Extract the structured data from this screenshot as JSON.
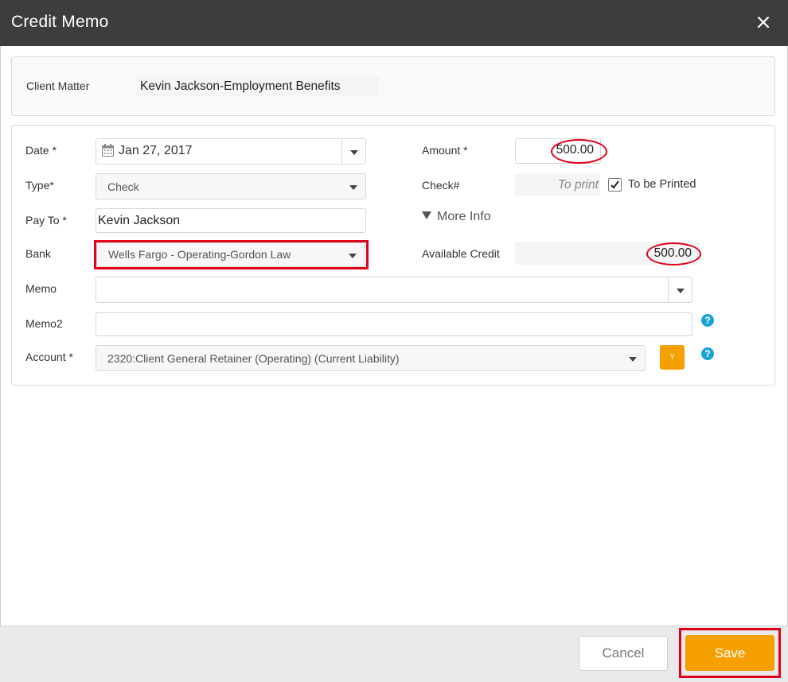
{
  "dialog": {
    "title": "Credit Memo"
  },
  "client_matter": {
    "label": "Client Matter",
    "value": "Kevin Jackson-Employment Benefits"
  },
  "form": {
    "date": {
      "label": "Date *",
      "value": "Jan 27, 2017"
    },
    "type": {
      "label": "Type*",
      "value": "Check"
    },
    "pay_to": {
      "label": "Pay To *",
      "value": "Kevin Jackson"
    },
    "bank": {
      "label": "Bank",
      "value": "Wells Fargo - Operating-Gordon Law"
    },
    "memo": {
      "label": "Memo",
      "value": ""
    },
    "memo2": {
      "label": "Memo2",
      "value": ""
    },
    "account": {
      "label": "Account *",
      "value": "2320:Client General Retainer (Operating) (Current Liability)",
      "button_label": "Y"
    },
    "amount": {
      "label": "Amount *",
      "value": "500.00"
    },
    "check_number": {
      "label": "Check#",
      "placeholder": "To print"
    },
    "to_be_printed": {
      "label": "To be Printed",
      "checked": true
    },
    "more_info": {
      "label": "More Info"
    },
    "available_credit": {
      "label": "Available Credit",
      "value": "500.00"
    },
    "help_glyph": "?"
  },
  "footer": {
    "cancel_label": "Cancel",
    "save_label": "Save"
  },
  "colors": {
    "titlebar": "#3d3d3d",
    "accent": "#f59f00",
    "help": "#1aa3d9",
    "annotation": "#e0001a"
  }
}
